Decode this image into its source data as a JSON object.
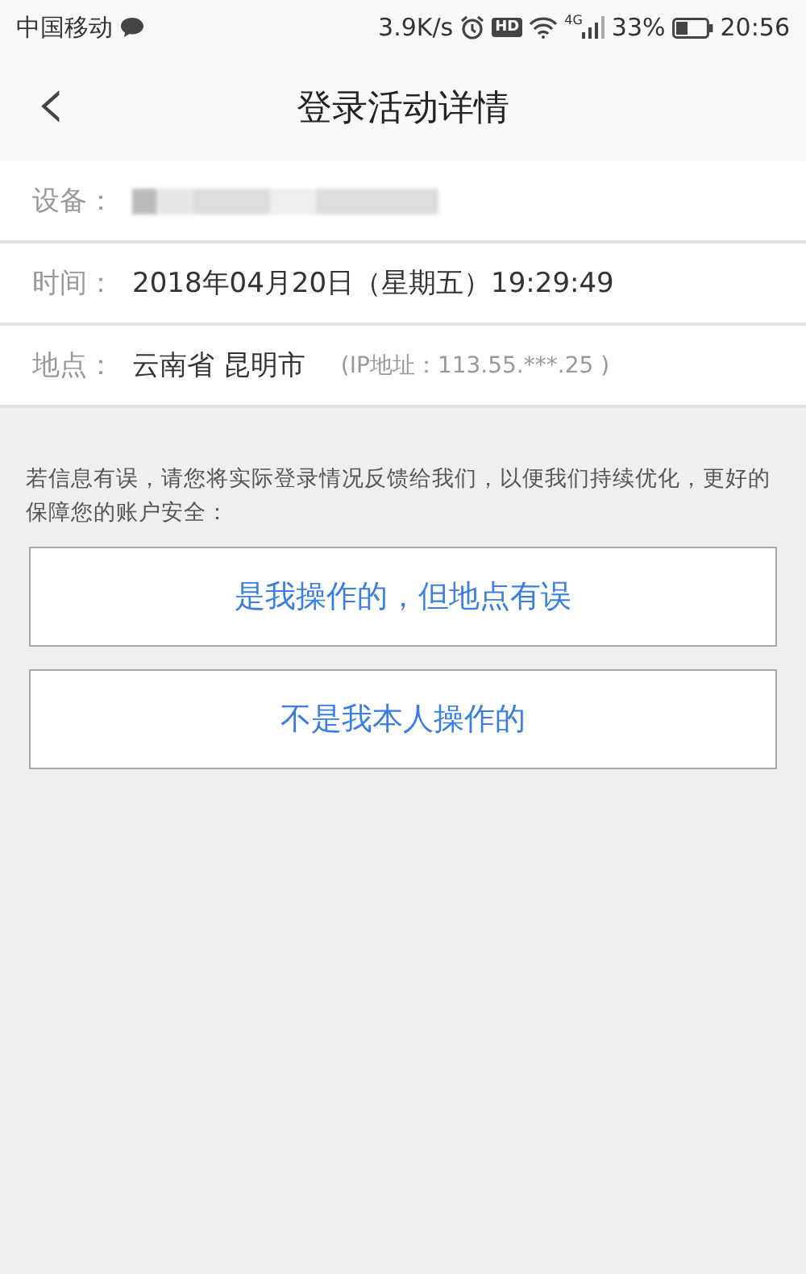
{
  "status_bar": {
    "carrier": "中国移动",
    "speed": "3.9K/s",
    "hd_badge": "HD",
    "network": "4G",
    "battery": "33%",
    "time": "20:56"
  },
  "header": {
    "back": "‹",
    "title": "登录活动详情"
  },
  "details": [
    {
      "label": "设备：",
      "redacted": true
    },
    {
      "label": "时间：",
      "value": "2018年04月20日（星期五）19:29:49"
    },
    {
      "label": "地点：",
      "value": "云南省 昆明市",
      "note": "(IP地址：113.55.***.25 )"
    }
  ],
  "notice": "若信息有误，请您将实际登录情况反馈给我们，以便我们持续优化，更好的保障您的账户安全：",
  "buttons": [
    "是我操作的，但地点有误",
    "不是我本人操作的"
  ]
}
